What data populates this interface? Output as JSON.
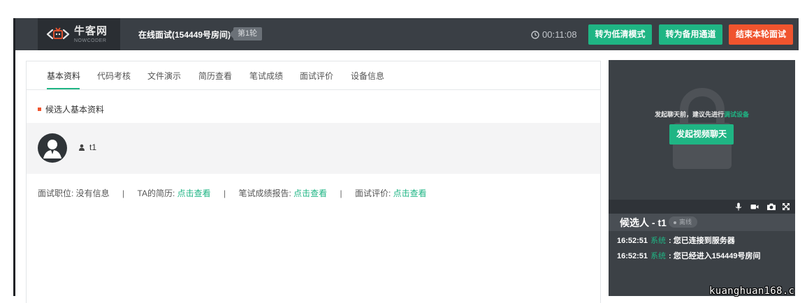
{
  "header": {
    "logo_cn": "牛客网",
    "logo_en": "NOWCODER",
    "room_title": "在线面试(154449号房间)",
    "round_badge": "第1轮",
    "timer": "00:11:08",
    "btn_low_quality": "转为低清模式",
    "btn_backup_channel": "转为备用通道",
    "btn_end_round": "结束本轮面试"
  },
  "tabs": [
    {
      "label": "基本资料",
      "active": true
    },
    {
      "label": "代码考核"
    },
    {
      "label": "文件演示"
    },
    {
      "label": "简历查看"
    },
    {
      "label": "笔试成绩"
    },
    {
      "label": "面试评价"
    },
    {
      "label": "设备信息"
    }
  ],
  "profile": {
    "section_title": "候选人基本资料",
    "username": "t1"
  },
  "info": {
    "position_label": "面试职位: ",
    "position_value": "没有信息",
    "resume_label": "TA的简历: ",
    "resume_link": "点击查看",
    "exam_label": "笔试成绩报告: ",
    "exam_link": "点击查看",
    "eval_label": "面试评价: ",
    "eval_link": "点击查看",
    "separator": "|"
  },
  "video": {
    "hint_prefix": "发起聊天前，建议先进行",
    "hint_link": "调试设备",
    "start_chat": "发起视频聊天"
  },
  "candidate": {
    "name": "候选人 - t1",
    "status": "离线"
  },
  "chat": [
    {
      "time": "16:52:51",
      "sender": "系统",
      "text": ": 您已连接到服务器"
    },
    {
      "time": "16:52:51",
      "sender": "系统",
      "text": ": 您已经进入154449号房间"
    }
  ],
  "watermark": "kuanghuan168.c",
  "colors": {
    "accent": "#1fb584",
    "danger": "#f0542e",
    "topbar": "#3a3f45",
    "panel": "#3c4146"
  }
}
